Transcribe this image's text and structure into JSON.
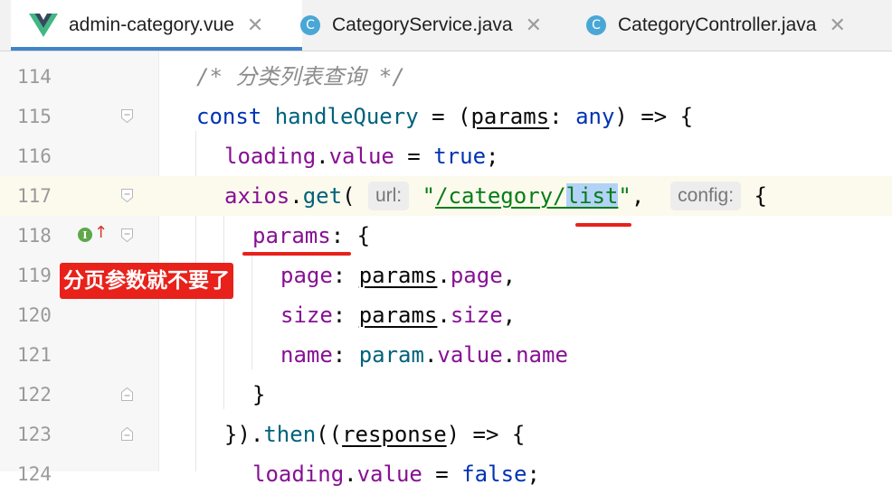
{
  "tabs": [
    {
      "label": "admin-category.vue",
      "active": true,
      "icon": "vue-logo-icon"
    },
    {
      "label": "CategoryService.java",
      "active": false,
      "icon": "java-class-icon"
    },
    {
      "label": "CategoryController.java",
      "active": false,
      "icon": "java-class-icon"
    }
  ],
  "close_glyph": "✕",
  "class_icon_letter": "C",
  "line_numbers": [
    "114",
    "115",
    "116",
    "117",
    "118",
    "119",
    "120",
    "121",
    "122",
    "123",
    "124"
  ],
  "code": {
    "l114": "/* 分类列表查询 */",
    "l115": {
      "kw": "const",
      "fn": "handleQuery",
      "eq": " = (",
      "param": "params",
      "colon": ": ",
      "type": "any",
      "rest": ") => {"
    },
    "l116": {
      "obj": "loading",
      "dot": ".",
      "prop": "value",
      "eq": " = ",
      "val": "true",
      "end": ";"
    },
    "l117": {
      "obj": "axios",
      "dot": ".",
      "fn": "get",
      "open": "(",
      "hint_url": "url:",
      "q1": "\"",
      "path": "/category/",
      "sel": "list",
      "q2": "\"",
      "comma": ", ",
      "hint_config": "config:",
      "brace": "{"
    },
    "l118": {
      "prop": "params",
      "rest": ": {"
    },
    "l119": {
      "prop": "page",
      "colon": ": ",
      "obj": "params",
      "dot": ".",
      "field": "page",
      "end": ","
    },
    "l120": {
      "prop": "size",
      "colon": ": ",
      "obj": "params",
      "dot": ".",
      "field": "size",
      "end": ","
    },
    "l121": {
      "prop": "name",
      "colon": ": ",
      "obj": "param",
      "dot": ".",
      "field1": "value",
      "dot2": ".",
      "field2": "name"
    },
    "l122": "}",
    "l123": {
      "start": "}).",
      "fn": "then",
      "open": "((",
      "param": "response",
      "rest": ") => {"
    },
    "l124": {
      "obj": "loading",
      "dot": ".",
      "prop": "value",
      "eq": " = ",
      "val": "false",
      "end": ";"
    }
  },
  "implements_glyph": "I",
  "override_arrow": "↑",
  "annotation": "分页参数就不要了",
  "colors": {
    "keyword": "#0033b3",
    "function": "#00627a",
    "property": "#871094",
    "string": "#067d17",
    "annotation_red": "#e8211b"
  }
}
